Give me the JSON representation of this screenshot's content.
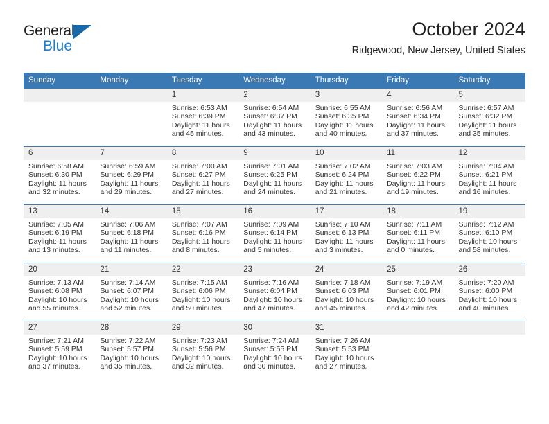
{
  "brand": {
    "name_part1": "General",
    "name_part2": "Blue",
    "triangle_color": "#1769aa",
    "blue_color": "#1b7fd4"
  },
  "header": {
    "title": "October 2024",
    "subtitle": "Ridgewood, New Jersey, United States"
  },
  "theme": {
    "header_blue": "#3b79b5",
    "daynum_band": "#efefef",
    "text": "#333333"
  },
  "calendar": {
    "weekday_headers": [
      "Sunday",
      "Monday",
      "Tuesday",
      "Wednesday",
      "Thursday",
      "Friday",
      "Saturday"
    ],
    "weeks": [
      [
        {
          "day": "",
          "empty": true
        },
        {
          "day": "",
          "empty": true
        },
        {
          "day": "1",
          "sunrise": "Sunrise: 6:53 AM",
          "sunset": "Sunset: 6:39 PM",
          "daylight1": "Daylight: 11 hours",
          "daylight2": "and 45 minutes."
        },
        {
          "day": "2",
          "sunrise": "Sunrise: 6:54 AM",
          "sunset": "Sunset: 6:37 PM",
          "daylight1": "Daylight: 11 hours",
          "daylight2": "and 43 minutes."
        },
        {
          "day": "3",
          "sunrise": "Sunrise: 6:55 AM",
          "sunset": "Sunset: 6:35 PM",
          "daylight1": "Daylight: 11 hours",
          "daylight2": "and 40 minutes."
        },
        {
          "day": "4",
          "sunrise": "Sunrise: 6:56 AM",
          "sunset": "Sunset: 6:34 PM",
          "daylight1": "Daylight: 11 hours",
          "daylight2": "and 37 minutes."
        },
        {
          "day": "5",
          "sunrise": "Sunrise: 6:57 AM",
          "sunset": "Sunset: 6:32 PM",
          "daylight1": "Daylight: 11 hours",
          "daylight2": "and 35 minutes."
        }
      ],
      [
        {
          "day": "6",
          "sunrise": "Sunrise: 6:58 AM",
          "sunset": "Sunset: 6:30 PM",
          "daylight1": "Daylight: 11 hours",
          "daylight2": "and 32 minutes."
        },
        {
          "day": "7",
          "sunrise": "Sunrise: 6:59 AM",
          "sunset": "Sunset: 6:29 PM",
          "daylight1": "Daylight: 11 hours",
          "daylight2": "and 29 minutes."
        },
        {
          "day": "8",
          "sunrise": "Sunrise: 7:00 AM",
          "sunset": "Sunset: 6:27 PM",
          "daylight1": "Daylight: 11 hours",
          "daylight2": "and 27 minutes."
        },
        {
          "day": "9",
          "sunrise": "Sunrise: 7:01 AM",
          "sunset": "Sunset: 6:25 PM",
          "daylight1": "Daylight: 11 hours",
          "daylight2": "and 24 minutes."
        },
        {
          "day": "10",
          "sunrise": "Sunrise: 7:02 AM",
          "sunset": "Sunset: 6:24 PM",
          "daylight1": "Daylight: 11 hours",
          "daylight2": "and 21 minutes."
        },
        {
          "day": "11",
          "sunrise": "Sunrise: 7:03 AM",
          "sunset": "Sunset: 6:22 PM",
          "daylight1": "Daylight: 11 hours",
          "daylight2": "and 19 minutes."
        },
        {
          "day": "12",
          "sunrise": "Sunrise: 7:04 AM",
          "sunset": "Sunset: 6:21 PM",
          "daylight1": "Daylight: 11 hours",
          "daylight2": "and 16 minutes."
        }
      ],
      [
        {
          "day": "13",
          "sunrise": "Sunrise: 7:05 AM",
          "sunset": "Sunset: 6:19 PM",
          "daylight1": "Daylight: 11 hours",
          "daylight2": "and 13 minutes."
        },
        {
          "day": "14",
          "sunrise": "Sunrise: 7:06 AM",
          "sunset": "Sunset: 6:18 PM",
          "daylight1": "Daylight: 11 hours",
          "daylight2": "and 11 minutes."
        },
        {
          "day": "15",
          "sunrise": "Sunrise: 7:07 AM",
          "sunset": "Sunset: 6:16 PM",
          "daylight1": "Daylight: 11 hours",
          "daylight2": "and 8 minutes."
        },
        {
          "day": "16",
          "sunrise": "Sunrise: 7:09 AM",
          "sunset": "Sunset: 6:14 PM",
          "daylight1": "Daylight: 11 hours",
          "daylight2": "and 5 minutes."
        },
        {
          "day": "17",
          "sunrise": "Sunrise: 7:10 AM",
          "sunset": "Sunset: 6:13 PM",
          "daylight1": "Daylight: 11 hours",
          "daylight2": "and 3 minutes."
        },
        {
          "day": "18",
          "sunrise": "Sunrise: 7:11 AM",
          "sunset": "Sunset: 6:11 PM",
          "daylight1": "Daylight: 11 hours",
          "daylight2": "and 0 minutes."
        },
        {
          "day": "19",
          "sunrise": "Sunrise: 7:12 AM",
          "sunset": "Sunset: 6:10 PM",
          "daylight1": "Daylight: 10 hours",
          "daylight2": "and 58 minutes."
        }
      ],
      [
        {
          "day": "20",
          "sunrise": "Sunrise: 7:13 AM",
          "sunset": "Sunset: 6:08 PM",
          "daylight1": "Daylight: 10 hours",
          "daylight2": "and 55 minutes."
        },
        {
          "day": "21",
          "sunrise": "Sunrise: 7:14 AM",
          "sunset": "Sunset: 6:07 PM",
          "daylight1": "Daylight: 10 hours",
          "daylight2": "and 52 minutes."
        },
        {
          "day": "22",
          "sunrise": "Sunrise: 7:15 AM",
          "sunset": "Sunset: 6:06 PM",
          "daylight1": "Daylight: 10 hours",
          "daylight2": "and 50 minutes."
        },
        {
          "day": "23",
          "sunrise": "Sunrise: 7:16 AM",
          "sunset": "Sunset: 6:04 PM",
          "daylight1": "Daylight: 10 hours",
          "daylight2": "and 47 minutes."
        },
        {
          "day": "24",
          "sunrise": "Sunrise: 7:18 AM",
          "sunset": "Sunset: 6:03 PM",
          "daylight1": "Daylight: 10 hours",
          "daylight2": "and 45 minutes."
        },
        {
          "day": "25",
          "sunrise": "Sunrise: 7:19 AM",
          "sunset": "Sunset: 6:01 PM",
          "daylight1": "Daylight: 10 hours",
          "daylight2": "and 42 minutes."
        },
        {
          "day": "26",
          "sunrise": "Sunrise: 7:20 AM",
          "sunset": "Sunset: 6:00 PM",
          "daylight1": "Daylight: 10 hours",
          "daylight2": "and 40 minutes."
        }
      ],
      [
        {
          "day": "27",
          "sunrise": "Sunrise: 7:21 AM",
          "sunset": "Sunset: 5:59 PM",
          "daylight1": "Daylight: 10 hours",
          "daylight2": "and 37 minutes."
        },
        {
          "day": "28",
          "sunrise": "Sunrise: 7:22 AM",
          "sunset": "Sunset: 5:57 PM",
          "daylight1": "Daylight: 10 hours",
          "daylight2": "and 35 minutes."
        },
        {
          "day": "29",
          "sunrise": "Sunrise: 7:23 AM",
          "sunset": "Sunset: 5:56 PM",
          "daylight1": "Daylight: 10 hours",
          "daylight2": "and 32 minutes."
        },
        {
          "day": "30",
          "sunrise": "Sunrise: 7:24 AM",
          "sunset": "Sunset: 5:55 PM",
          "daylight1": "Daylight: 10 hours",
          "daylight2": "and 30 minutes."
        },
        {
          "day": "31",
          "sunrise": "Sunrise: 7:26 AM",
          "sunset": "Sunset: 5:53 PM",
          "daylight1": "Daylight: 10 hours",
          "daylight2": "and 27 minutes."
        },
        {
          "day": "",
          "empty": true
        },
        {
          "day": "",
          "empty": true
        }
      ]
    ]
  }
}
